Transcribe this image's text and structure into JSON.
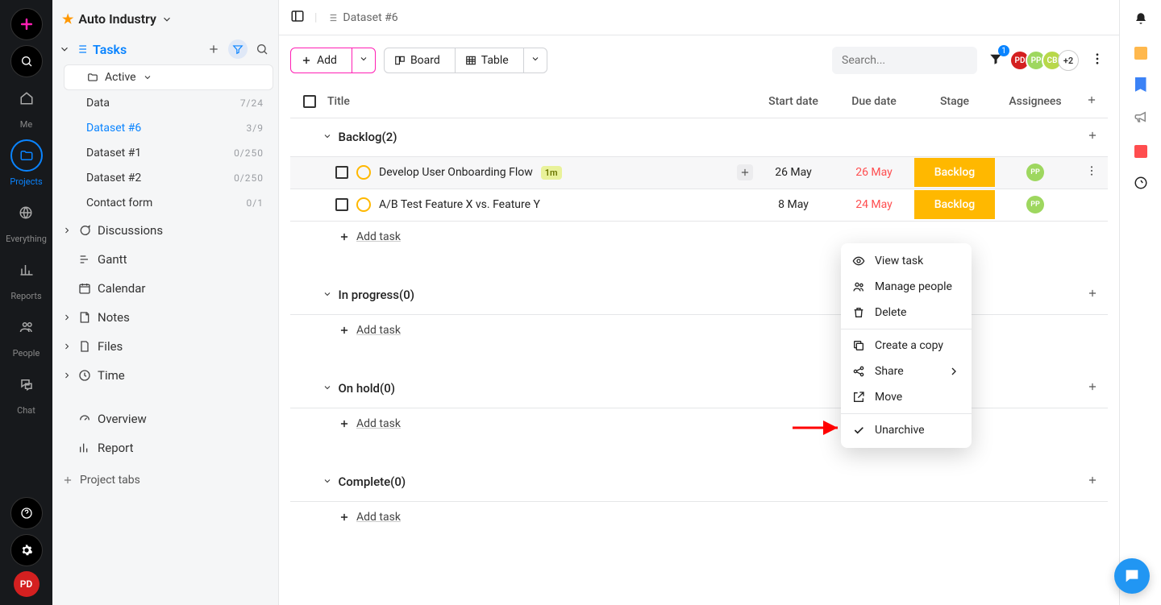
{
  "rail": {
    "me": "Me",
    "projects": "Projects",
    "everything": "Everything",
    "reports": "Reports",
    "people": "People",
    "chat": "Chat",
    "user_initials": "PD"
  },
  "project": {
    "name": "Auto Industry"
  },
  "tasks_section": {
    "title": "Tasks",
    "active_folder": "Active",
    "items": [
      {
        "name": "Data",
        "count": "7/24",
        "selected": false
      },
      {
        "name": "Dataset #6",
        "count": "3/9",
        "selected": true
      },
      {
        "name": "Dataset #1",
        "count": "0/250",
        "selected": false
      },
      {
        "name": "Dataset #2",
        "count": "0/250",
        "selected": false
      },
      {
        "name": "Contact form",
        "count": "0/1",
        "selected": false
      }
    ]
  },
  "nav": {
    "discussions": "Discussions",
    "gantt": "Gantt",
    "calendar": "Calendar",
    "notes": "Notes",
    "files": "Files",
    "time": "Time",
    "overview": "Overview",
    "report": "Report",
    "project_tabs": "Project tabs"
  },
  "breadcrumb": "Dataset #6",
  "toolbar": {
    "add": "Add",
    "board": "Board",
    "table": "Table",
    "search_placeholder": "Search...",
    "filter_count": "1",
    "avatars": [
      "PD",
      "PP",
      "CB"
    ],
    "more": "+2"
  },
  "columns": {
    "title": "Title",
    "start": "Start date",
    "due": "Due date",
    "stage": "Stage",
    "assignees": "Assignees"
  },
  "groups": [
    {
      "name": "Backlog",
      "count": 2,
      "tasks": [
        {
          "title": "Develop User Onboarding Flow",
          "badge": "1m",
          "start": "26 May",
          "due": "26 May",
          "due_late": true,
          "stage": "Backlog",
          "assignee": "PP",
          "hovered": true,
          "show_actions": true
        },
        {
          "title": "A/B Test Feature X vs. Feature Y",
          "badge": "",
          "start": "8 May",
          "due": "24 May",
          "due_late": true,
          "stage": "Backlog",
          "assignee": "PP",
          "hovered": false,
          "show_actions": false
        }
      ]
    },
    {
      "name": "In progress",
      "count": 0,
      "tasks": []
    },
    {
      "name": "On hold",
      "count": 0,
      "tasks": []
    },
    {
      "name": "Complete",
      "count": 0,
      "tasks": []
    }
  ],
  "add_task_label": "Add task",
  "context_menu": {
    "view": "View task",
    "manage": "Manage people",
    "delete": "Delete",
    "copy": "Create a copy",
    "share": "Share",
    "move": "Move",
    "unarchive": "Unarchive"
  }
}
